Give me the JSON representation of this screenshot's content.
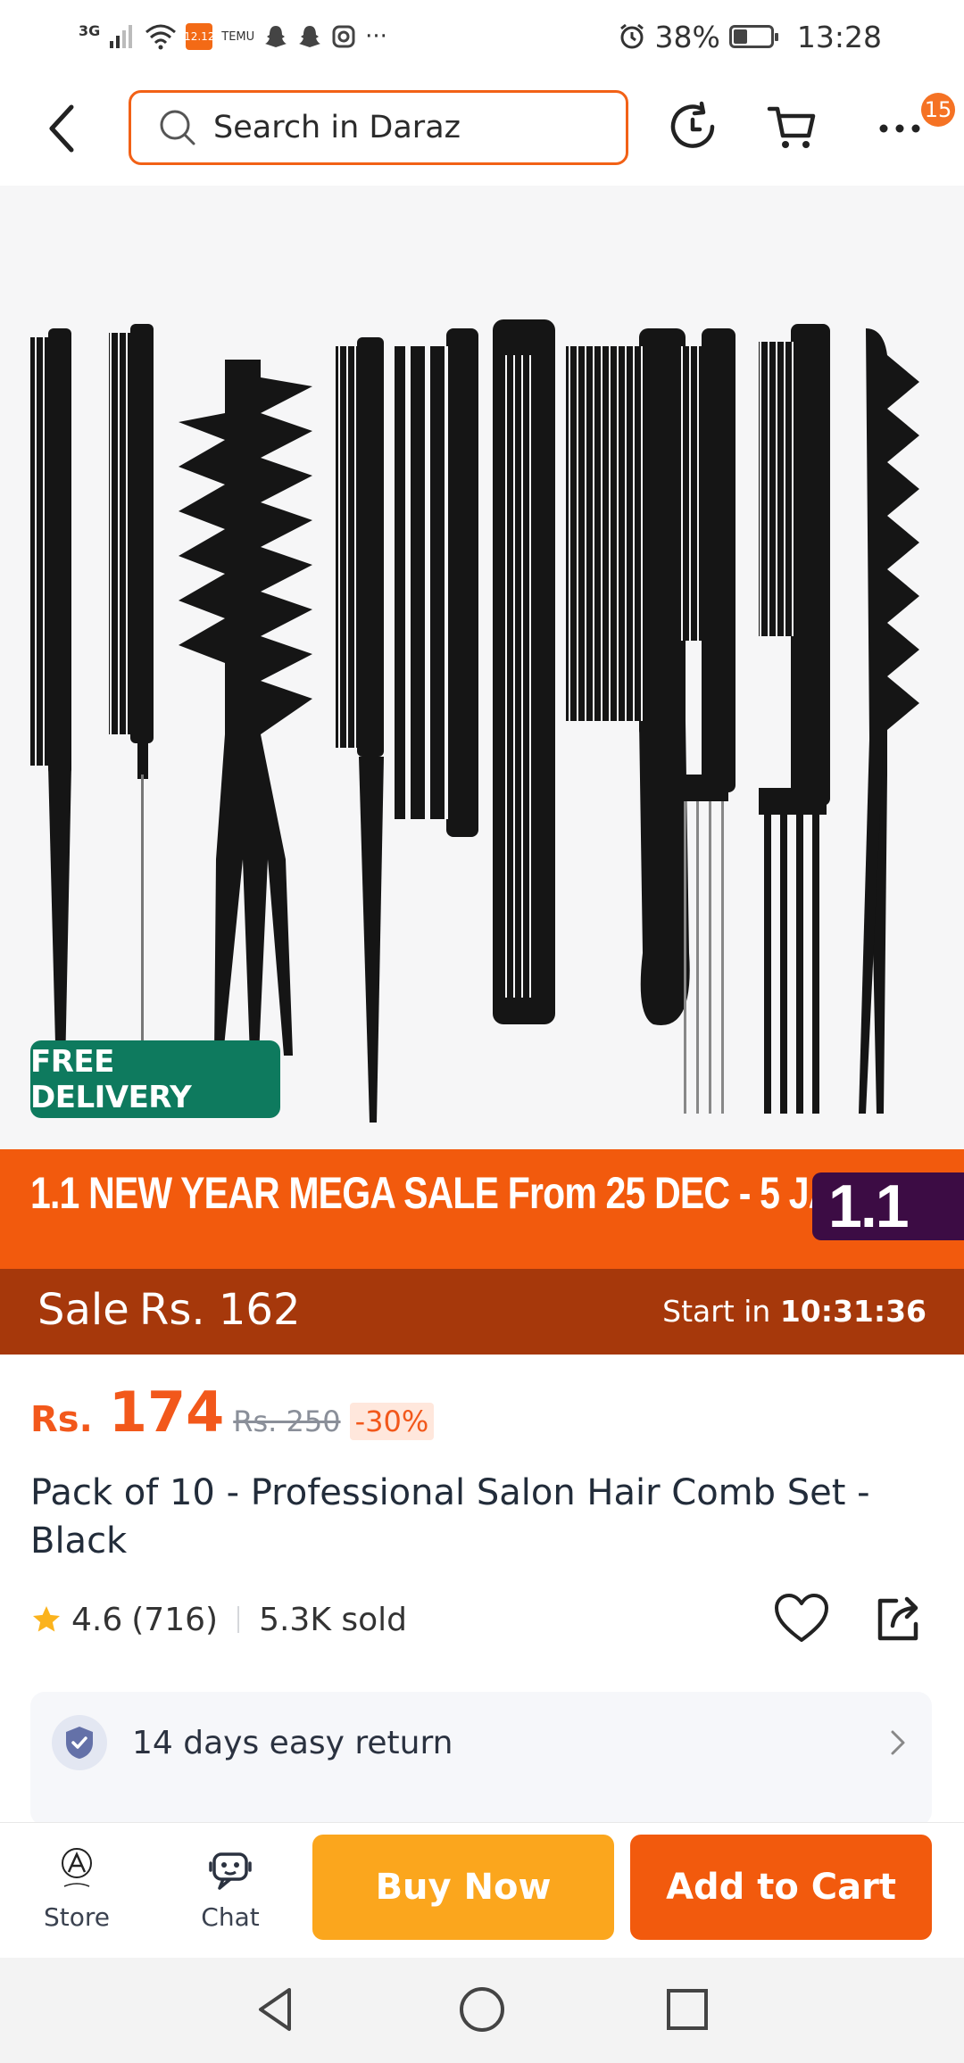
{
  "status_bar": {
    "network": "3G",
    "app_badge": "12.12",
    "temu": "TEMU",
    "more": "···",
    "battery": "38%",
    "battery_level": 0.38,
    "time": "13:28"
  },
  "header": {
    "search_placeholder": "Search in Daraz",
    "cart_badge": "15"
  },
  "product": {
    "image_alt": "Set of 10 black salon combs",
    "free_delivery": "FREE DELIVERY",
    "promo_text": "1.1 NEW YEAR MEGA SALE From 25 DEC - 5 JAN",
    "promo_tag": "1.1",
    "sale_label": "Sale",
    "sale_price": "Rs. 162",
    "sale_start_label": "Start in",
    "sale_countdown": "10:31:36",
    "currency": "Rs.",
    "price": "174",
    "original_price": "Rs. 250",
    "discount": "-30%",
    "title": "Pack of 10 - Professional Salon Hair Comb Set - Black",
    "rating": "4.6",
    "review_count": "(716)",
    "sold": "5.3K sold"
  },
  "service": {
    "return_policy": "14 days easy return"
  },
  "bottom_bar": {
    "store_label": "Store",
    "chat_label": "Chat",
    "buy_now": "Buy Now",
    "add_to_cart": "Add to Cart"
  },
  "colors": {
    "brand_orange": "#f25a0d",
    "buy_now": "#fba61d",
    "free_delivery_green": "#0e7a5e",
    "sale_bar": "#a6380b"
  }
}
